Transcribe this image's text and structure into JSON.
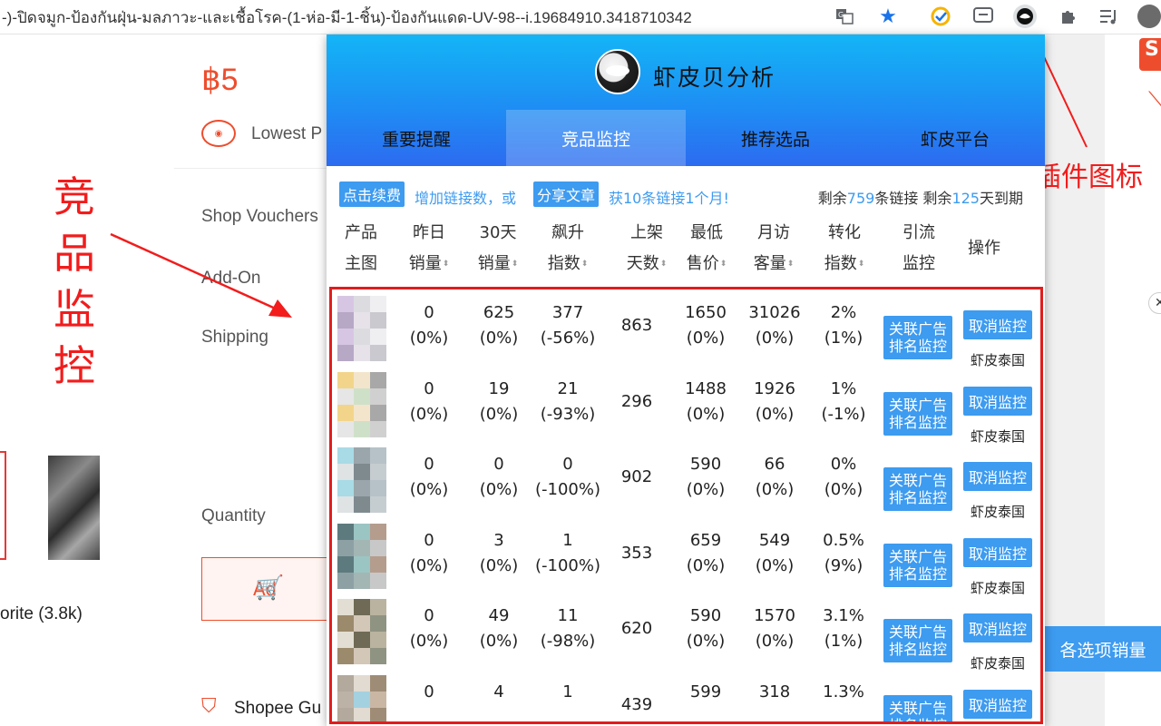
{
  "browser": {
    "url_text": "-)-ปิดจมูก-ป้องกันฝุ่น-มลภาวะ-และเชื้อโรค-(1-ห่อ-มี-1-ชิ้น)-ป้องกันแดด-UV-98--i.19684910.3418710342",
    "icons": [
      "translate-icon",
      "star-icon",
      "check-extension-icon",
      "chat-extension-icon",
      "shrimp-extension-icon",
      "puzzle-icon",
      "media-icon",
      "profile-avatar-icon"
    ]
  },
  "background_page": {
    "price": "฿5",
    "lowest_price": "Lowest P",
    "shop_vouchers": "Shop Vouchers",
    "add_on": "Add-On",
    "shipping": "Shipping",
    "quantity": "Quantity",
    "add_to_cart": "Ad",
    "favorite": "orite (3.8k)",
    "shopee_guarantee": "Shopee Gu",
    "right_button": "各选项销量",
    "logo_letter": "S"
  },
  "annotations": {
    "left": "竞品监控",
    "right": "点击插件图标"
  },
  "popup": {
    "title": "虾皮贝分析",
    "tabs": [
      {
        "label": "重要提醒",
        "active": false
      },
      {
        "label": "竞品监控",
        "active": true
      },
      {
        "label": "推荐选品",
        "active": false
      },
      {
        "label": "虾皮平台",
        "active": false
      }
    ],
    "info": {
      "renew_button": "点击续费",
      "add_links_text": "增加链接数，或",
      "share_button": "分享文章",
      "reward_text": "获10条链接1个月!",
      "remaining_prefix": "剩余",
      "remaining_links": "759",
      "links_unit": "条链接",
      "remaining_prefix2": "剩余",
      "remaining_days": "125",
      "days_unit": "天到期"
    },
    "columns": [
      {
        "line1": "产品",
        "line2": "主图",
        "sort": false
      },
      {
        "line1": "昨日",
        "line2": "销量",
        "sort": true
      },
      {
        "line1": "30天",
        "line2": "销量",
        "sort": true
      },
      {
        "line1": "飙升",
        "line2": "指数",
        "sort": true
      },
      {
        "line1": "上架",
        "line2": "天数",
        "sort": true
      },
      {
        "line1": "最低",
        "line2": "售价",
        "sort": true
      },
      {
        "line1": "月访",
        "line2": "客量",
        "sort": true
      },
      {
        "line1": "转化",
        "line2": "指数",
        "sort": true
      },
      {
        "line1": "引流",
        "line2": "监控",
        "sort": false
      },
      {
        "line1": "操作",
        "line2": "",
        "sort": false
      }
    ],
    "ad_button": "关联广告\n排名监控",
    "cancel_button": "取消监控",
    "site_label": "虾皮泰国",
    "rows": [
      {
        "yesterday": "0",
        "yesterday_pct": "(0%)",
        "sales30": "625",
        "sales30_pct": "(0%)",
        "surge": "377",
        "surge_pct": "(-56%)",
        "days": "863",
        "min_price": "1650",
        "min_price_pct": "(0%)",
        "visits": "31026",
        "visits_pct": "(0%)",
        "conv": "2%",
        "conv_pct": "(1%)"
      },
      {
        "yesterday": "0",
        "yesterday_pct": "(0%)",
        "sales30": "19",
        "sales30_pct": "(0%)",
        "surge": "21",
        "surge_pct": "(-93%)",
        "days": "296",
        "min_price": "1488",
        "min_price_pct": "(0%)",
        "visits": "1926",
        "visits_pct": "(0%)",
        "conv": "1%",
        "conv_pct": "(-1%)"
      },
      {
        "yesterday": "0",
        "yesterday_pct": "(0%)",
        "sales30": "0",
        "sales30_pct": "(0%)",
        "surge": "0",
        "surge_pct": "(-100%)",
        "days": "902",
        "min_price": "590",
        "min_price_pct": "(0%)",
        "visits": "66",
        "visits_pct": "(0%)",
        "conv": "0%",
        "conv_pct": "(0%)"
      },
      {
        "yesterday": "0",
        "yesterday_pct": "(0%)",
        "sales30": "3",
        "sales30_pct": "(0%)",
        "surge": "1",
        "surge_pct": "(-100%)",
        "days": "353",
        "min_price": "659",
        "min_price_pct": "(0%)",
        "visits": "549",
        "visits_pct": "(0%)",
        "conv": "0.5%",
        "conv_pct": "(9%)"
      },
      {
        "yesterday": "0",
        "yesterday_pct": "(0%)",
        "sales30": "49",
        "sales30_pct": "(0%)",
        "surge": "11",
        "surge_pct": "(-98%)",
        "days": "620",
        "min_price": "590",
        "min_price_pct": "(0%)",
        "visits": "1570",
        "visits_pct": "(0%)",
        "conv": "3.1%",
        "conv_pct": "(1%)"
      },
      {
        "yesterday": "0",
        "yesterday_pct": "",
        "sales30": "4",
        "sales30_pct": "",
        "surge": "1",
        "surge_pct": "",
        "days": "439",
        "min_price": "599",
        "min_price_pct": "",
        "visits": "318",
        "visits_pct": "",
        "conv": "1.3%",
        "conv_pct": ""
      }
    ]
  }
}
